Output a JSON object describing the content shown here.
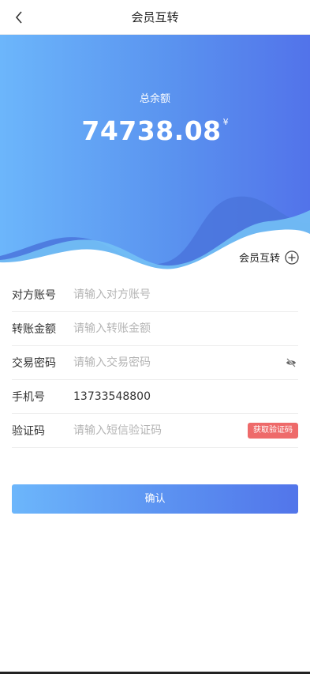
{
  "header": {
    "title": "会员互转"
  },
  "balance": {
    "label": "总余额",
    "amount": "74738.08",
    "currency": "¥"
  },
  "transfer_link": {
    "label": "会员互转"
  },
  "form": {
    "account": {
      "label": "对方账号",
      "placeholder": "请输入对方账号"
    },
    "amount": {
      "label": "转账金额",
      "placeholder": "请输入转账金额"
    },
    "password": {
      "label": "交易密码",
      "placeholder": "请输入交易密码"
    },
    "phone": {
      "label": "手机号",
      "value": "13733548800"
    },
    "code": {
      "label": "验证码",
      "placeholder": "请输入短信验证码",
      "button": "获取验证码"
    }
  },
  "confirm_label": "确认",
  "colors": {
    "gradient_start": "#6cb6fb",
    "gradient_end": "#5273ea",
    "code_button": "#ee6a6a"
  },
  "icons": {
    "back": "chevron-left-icon",
    "add": "plus-circle-icon",
    "eye": "eye-off-icon"
  }
}
